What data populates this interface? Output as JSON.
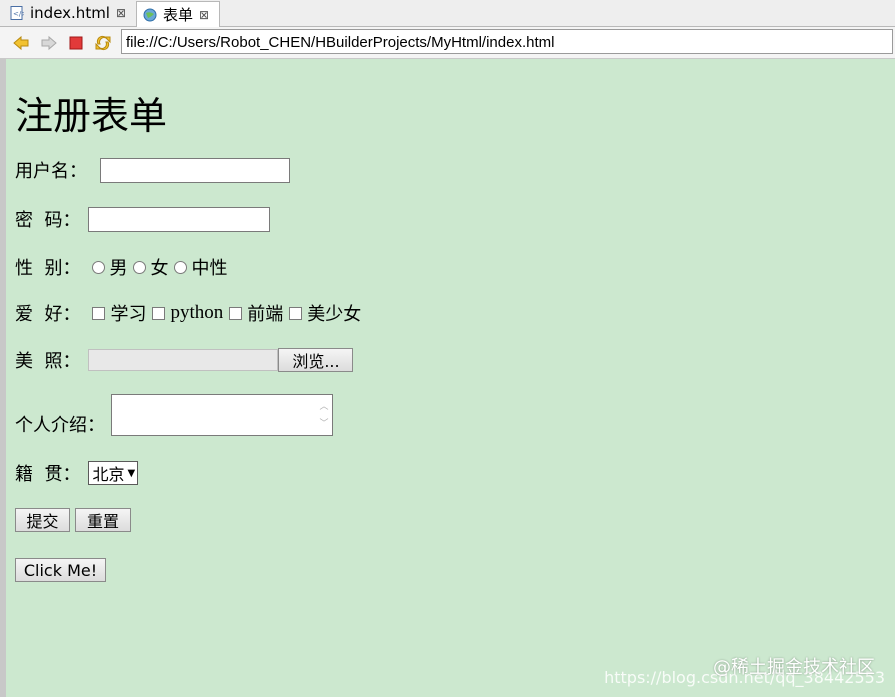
{
  "tabs": [
    {
      "label": "index.html",
      "close": "⊠"
    },
    {
      "label": "表单",
      "close": "⊠"
    }
  ],
  "toolbar": {
    "url": "file://C:/Users/Robot_CHEN/HBuilderProjects/MyHtml/index.html"
  },
  "form": {
    "title": "注册表单",
    "username_label": "用户名：",
    "password_label": "密  码：",
    "gender_label": "性  别：",
    "gender_options": [
      "男",
      "女",
      "中性"
    ],
    "hobby_label": "爱  好：",
    "hobby_options": [
      "学习",
      "python",
      "前端",
      "美少女"
    ],
    "photo_label": "美  照：",
    "browse_label": "浏览...",
    "intro_label": "个人介绍：",
    "hometown_label": "籍  贯：",
    "hometown_value": "北京",
    "submit_label": "提交",
    "reset_label": "重置",
    "click_label": "Click Me!"
  },
  "watermark": {
    "brand": "@稀土掘金技术社区",
    "url": "https://blog.csdn.net/qq_38442553"
  }
}
